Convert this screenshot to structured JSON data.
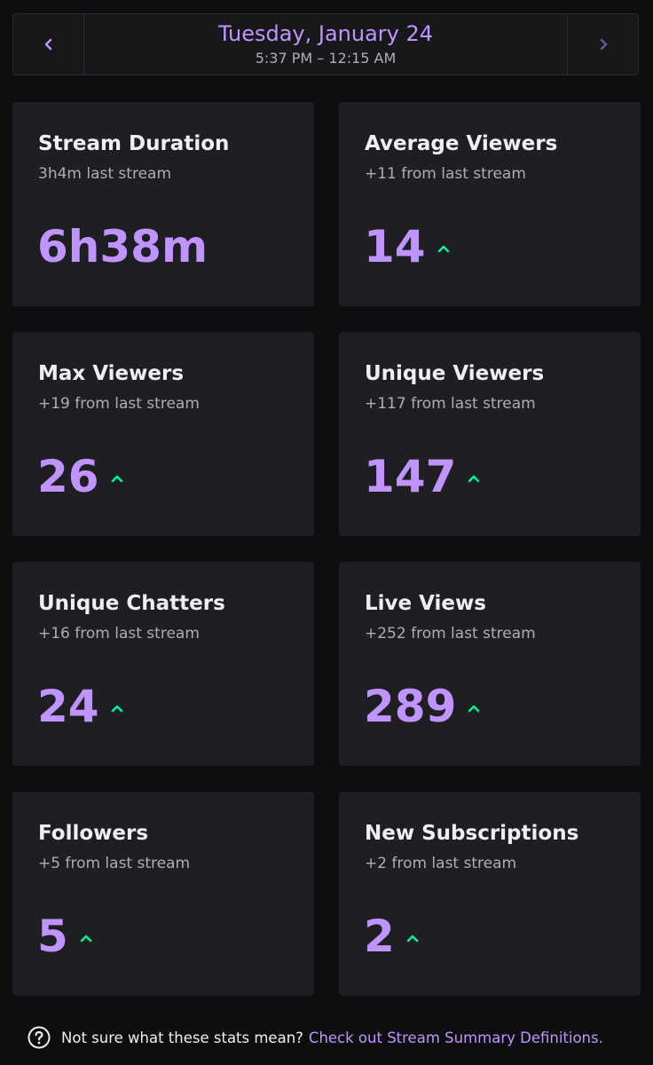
{
  "header": {
    "date": "Tuesday, January 24",
    "time_range": "5:37 PM – 12:15 AM",
    "prev_icon": "chevron-left-icon",
    "next_icon": "chevron-right-icon"
  },
  "colors": {
    "background": "#0e0e10",
    "card": "#1f1f23",
    "accent": "#bf94ff",
    "up": "#00f593",
    "muted": "#adadb8"
  },
  "cards": [
    {
      "title": "Stream Duration",
      "subtitle": "3h4m last stream",
      "value": "6h38m",
      "trend": "none"
    },
    {
      "title": "Average Viewers",
      "subtitle": "+11 from last stream",
      "value": "14",
      "trend": "up"
    },
    {
      "title": "Max Viewers",
      "subtitle": "+19 from last stream",
      "value": "26",
      "trend": "up"
    },
    {
      "title": "Unique Viewers",
      "subtitle": "+117 from last stream",
      "value": "147",
      "trend": "up"
    },
    {
      "title": "Unique Chatters",
      "subtitle": "+16 from last stream",
      "value": "24",
      "trend": "up"
    },
    {
      "title": "Live Views",
      "subtitle": "+252 from last stream",
      "value": "289",
      "trend": "up"
    },
    {
      "title": "Followers",
      "subtitle": "+5 from last stream",
      "value": "5",
      "trend": "up"
    },
    {
      "title": "New Subscriptions",
      "subtitle": "+2 from last stream",
      "value": "2",
      "trend": "up"
    }
  ],
  "footer": {
    "text": "Not sure what these stats mean?",
    "link": "Check out Stream Summary Definitions.",
    "icon": "help-circle-icon"
  }
}
